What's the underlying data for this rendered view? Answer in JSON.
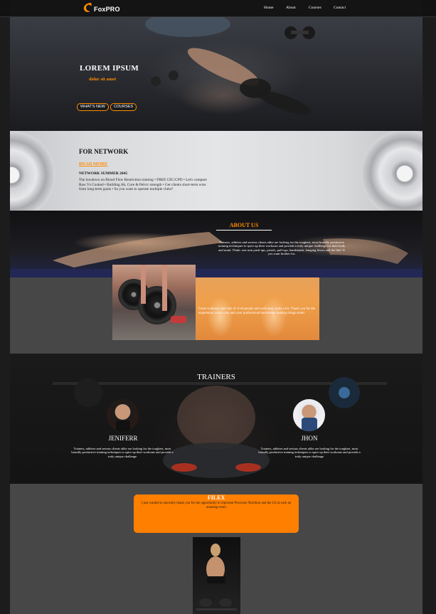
{
  "nav": {
    "logo_text": "FoxPRO",
    "links": [
      "Home",
      "About",
      "Courses",
      "Contact"
    ]
  },
  "hero": {
    "title": "LOREM IPSUM",
    "subtitle": "dolor sit amet",
    "buttons": [
      "WHAT'S NEW",
      "COURSES"
    ]
  },
  "network": {
    "title": "FOR NETWORK",
    "link": "READ MORE",
    "heading": "NETWORK SUMMER 2045",
    "body": "The lowdown on Blood Flow Restriction training • FREE CEC/CPD • Let's compare Raw Vs Cooked • Building Ab, Core & Pelvic strength • Get clients short-term wins from long-term goals • So you want to operate multiple clubs?"
  },
  "about": {
    "title": "ABOUT US",
    "text": "Trainers, athletes and serious clients alike are looking for the toughest, most brutally productive training techniques to spice up their workouts and provide a truly unique challenge for their body and mind. Think: one-arm push-ups, pistols, pull-ups, handstands, hanging levers and the like! If you want brother for."
  },
  "photo_row": {
    "text": "Great workouts start lots of vivid people and well-away quite a bit. Thank you for the experience, and to you and your professional knowledge making things smart."
  },
  "trainers": {
    "title": "TRAINERS",
    "items": [
      {
        "name": "JENIFERR",
        "desc": "Trainers, athletes and serious clients alike are looking for the toughest, most brutally productive training techniques to spice up their workouts and provide a truly unique challenge"
      },
      {
        "name": "JHON",
        "desc": "Trainers, athletes and serious clients alike are looking for the toughest, most brutally productive training techniques to spice up their workouts and provide a truly unique challenge"
      }
    ]
  },
  "filex": {
    "title": "FILEX",
    "text": "I just wanted to sincerely thank you for the opportunity to represent Precision Nutrition and the US at such an amazing event"
  },
  "colors": {
    "accent": "#ff8c00",
    "filex_bg": "#ff7f00",
    "page_bg": "#474747",
    "outer_bg": "#1c1c1c"
  }
}
